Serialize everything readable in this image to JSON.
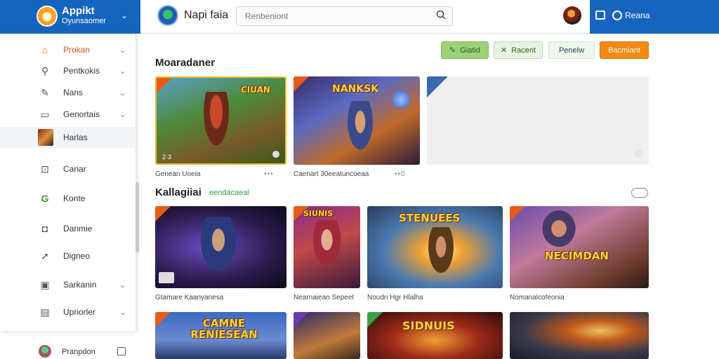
{
  "brand": {
    "title": "Appikt",
    "subtitle": "Oyunsaomer"
  },
  "header": {
    "app_title": "Napi faia",
    "search_placeholder": "Renbeniont"
  },
  "topright": {
    "label": "Reana"
  },
  "sidebar": {
    "items": [
      {
        "label": "Prokan",
        "icon": "home-icon"
      },
      {
        "label": "Pentkokis",
        "icon": "search-icon"
      },
      {
        "label": "Nans",
        "icon": "edit-icon"
      },
      {
        "label": "Genortais",
        "icon": "screen-icon"
      },
      {
        "label": "Harlas",
        "icon": "game-avatar-icon"
      },
      {
        "label": "Canar",
        "icon": "gamepad-icon"
      },
      {
        "label": "Konte",
        "icon": "google-icon"
      },
      {
        "label": "Danmie",
        "icon": "chat-icon"
      },
      {
        "label": "Digneo",
        "icon": "share-icon"
      },
      {
        "label": "Sarkanin",
        "icon": "image-icon"
      },
      {
        "label": "Upriorler",
        "icon": "card-icon"
      }
    ],
    "footer_label": "Pranpdon"
  },
  "actions": {
    "btn1": "Giatid",
    "btn2": "Racent",
    "btn3": "Penelw",
    "btn4": "Bacmiant"
  },
  "sections": {
    "featured_title": "Moaradaner",
    "featured_captions": [
      "Genean Uoeia",
      "Caenart 30eeatuncoeaa",
      ""
    ],
    "category_title": "Kallagiiai",
    "category_tag": "eendacaeal"
  },
  "cards": {
    "f1_art": "CIUAN",
    "f1_badge": "2·3",
    "f2_art": "NANKSK",
    "g1_art": "",
    "g1_caption": "Gtamare Kaanyanesa",
    "g2_art": "SIUNIS",
    "g2_caption": "Nearnaiean Sepeet",
    "g3_art": "STENUEES",
    "g3_caption": "Noudn Hgr Hlalha",
    "g4_art": "NECIMDAN",
    "g4_caption": "Nomanalcofeonia",
    "h1_art": "CAMNE RENIESEAN",
    "h3_art": "SIDNUIS"
  }
}
